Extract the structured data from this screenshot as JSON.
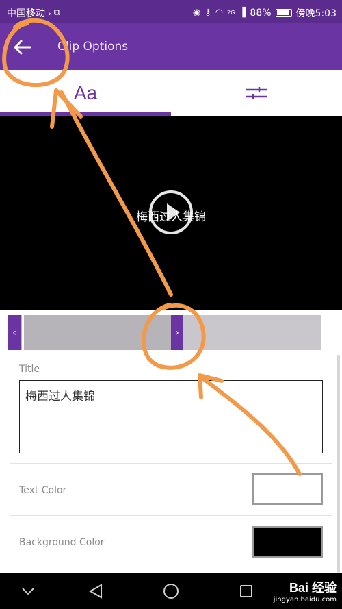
{
  "status_bar": {
    "carrier": "中国移动",
    "battery_percent": "88%",
    "time": "傍晚5:03",
    "network": "2G"
  },
  "app_bar": {
    "title": "Clip Options",
    "back_icon": "arrow-left-icon"
  },
  "tabs": [
    {
      "label": "Aa",
      "selected": true
    },
    {
      "icon": "sliders-icon",
      "selected": false
    }
  ],
  "video": {
    "caption": "梅西过人集锦",
    "play_icon": "play-icon"
  },
  "timeline": {
    "left_handle": "‹",
    "right_handle": "›"
  },
  "options": {
    "title_label": "Title",
    "title_value": "梅西过人集锦",
    "text_color_label": "Text Color",
    "text_color": "#ffffff",
    "background_color_label": "Background Color",
    "background_color": "#000000"
  },
  "nav_bar": {
    "icons": [
      "chevron-down-icon",
      "back-triangle-icon",
      "home-circle-icon",
      "recent-square-icon"
    ]
  },
  "watermark": {
    "logo": "Bai 经验",
    "url": "jingyan.baidu.com"
  },
  "colors": {
    "accent": "#6a34a3",
    "status_bar": "#5b2c8e",
    "annotation": "#f39a4a"
  }
}
